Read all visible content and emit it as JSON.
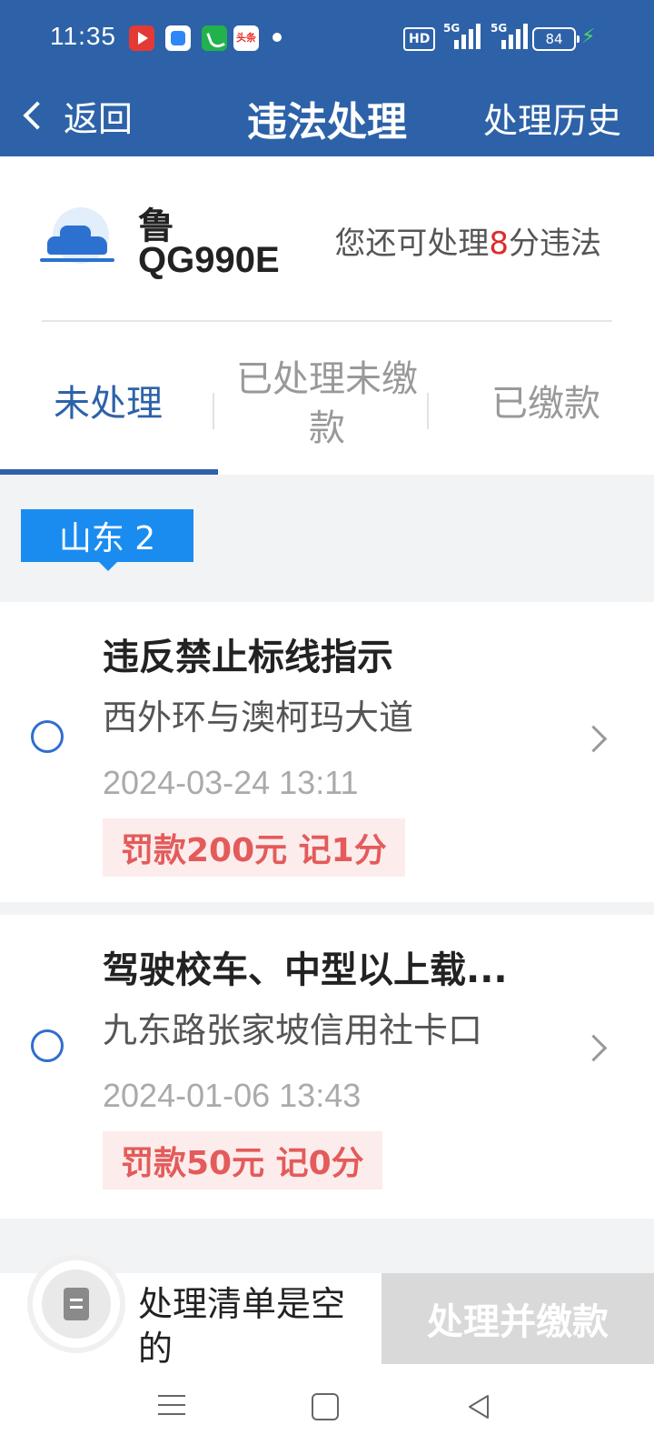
{
  "status_bar": {
    "time": "11:35",
    "app_icons": [
      "video-app-icon",
      "browser-app-icon",
      "phone-app-icon",
      "toutiao-app-icon"
    ],
    "toutiao_label": "头条",
    "hd_label": "HD",
    "signal1_label": "5G",
    "signal2_label": "5G",
    "battery": "84"
  },
  "nav": {
    "back_label": "返回",
    "title": "违法处理",
    "history_label": "处理历史"
  },
  "vehicle": {
    "plate_province": "鲁",
    "plate_number": "QG990E",
    "remain_prefix": "您还可处理",
    "remain_points": "8",
    "remain_suffix": "分违法"
  },
  "tabs": [
    {
      "label": "未处理",
      "active": true
    },
    {
      "label": "已处理未缴款",
      "active": false
    },
    {
      "label": "已缴款",
      "active": false
    }
  ],
  "region_tag": "山东 2",
  "violations": [
    {
      "title": "违反禁止标线指示",
      "location": "西外环与澳柯玛大道",
      "datetime": "2024-03-24 13:11",
      "penalty": "罚款200元 记1分"
    },
    {
      "title": "驾驶校车、中型以上载...",
      "location": "九东路张家坡信用社卡口",
      "datetime": "2024-01-06 13:43",
      "penalty": "罚款50元 记0分"
    }
  ],
  "bottom_bar": {
    "empty_text": "处理清单是空的",
    "pay_label": "处理并缴款"
  },
  "colors": {
    "primary": "#2d62a8",
    "region_tag": "#1a8cf0",
    "penalty_text": "#e35b5b",
    "penalty_bg": "#fdecec",
    "remain_points": "#e02a2a"
  }
}
